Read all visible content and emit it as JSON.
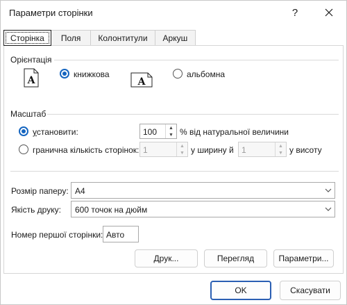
{
  "window": {
    "title": "Параметри сторінки",
    "help_glyph": "?"
  },
  "tabs": [
    {
      "label": "Сторінка"
    },
    {
      "label": "Поля"
    },
    {
      "label": "Колонтитули"
    },
    {
      "label": "Аркуш"
    }
  ],
  "orientation": {
    "label": "Орієнтація",
    "portrait_label": "книжкова",
    "landscape_label": "альбомна",
    "selected": "portrait",
    "icon_letter": "A"
  },
  "scale": {
    "label": "Масштаб",
    "set_label": "установити:",
    "set_value": "100",
    "set_suffix": "% від натуральної величини",
    "fit_label": "гранична кількість сторінок:",
    "fit_wide_value": "1",
    "fit_wide_suffix": "у ширину й",
    "fit_tall_value": "1",
    "fit_tall_suffix": "у висоту",
    "selected": "set"
  },
  "paper": {
    "label": "Розмір паперу:",
    "value": "A4"
  },
  "quality": {
    "label": "Якість друку:",
    "value": "600 точок на дюйм"
  },
  "first_page": {
    "label": "Номер першої сторінки:",
    "value": "Авто"
  },
  "actions": {
    "print": "Друк...",
    "preview": "Перегляд",
    "options": "Параметри..."
  },
  "footer": {
    "ok": "OK",
    "cancel": "Скасувати"
  },
  "colors": {
    "accent": "#1565c0",
    "primary_border": "#2b5fb3"
  }
}
